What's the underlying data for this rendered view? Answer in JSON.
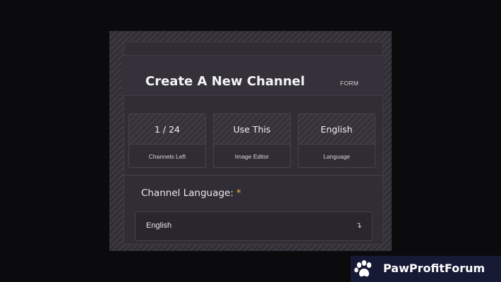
{
  "header": {
    "title": "Create A New Channel",
    "tag": "FORM"
  },
  "stats": [
    {
      "value": "1 / 24",
      "label": "Channels Left"
    },
    {
      "value": "Use This",
      "label": "Image Editor"
    },
    {
      "value": "English",
      "label": "Language"
    }
  ],
  "form": {
    "language_label": "Channel Language:",
    "required_mark": "*",
    "language_value": "English"
  },
  "icons": {
    "select_arrow": "arrow-turn-down-icon",
    "paw": "paw-icon"
  },
  "watermark": {
    "text": "PawProfitForum"
  },
  "colors": {
    "background": "#0b0b0d",
    "panel": "#302d34",
    "required": "#e0b54a",
    "badge": "#161a35"
  }
}
